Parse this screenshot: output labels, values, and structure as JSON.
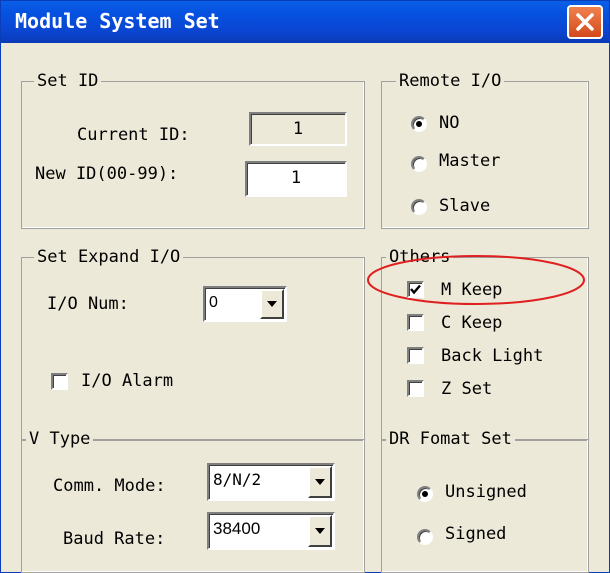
{
  "window": {
    "title": "Module System Set"
  },
  "set_id": {
    "label": "Set ID",
    "current_label": "Current ID:",
    "current_value": "1",
    "new_label": "New ID(00-99):",
    "new_value": "1"
  },
  "remote_io": {
    "label": "Remote I/O",
    "options": [
      "NO",
      "Master",
      "Slave"
    ],
    "selected": "NO"
  },
  "expand_io": {
    "label": "Set Expand I/O",
    "num_label": "I/O Num:",
    "num_value": "0",
    "alarm_label": "I/O Alarm",
    "alarm_checked": false
  },
  "others": {
    "label": "Others",
    "items": [
      {
        "label": "M Keep",
        "checked": true
      },
      {
        "label": "C Keep",
        "checked": false
      },
      {
        "label": "Back Light",
        "checked": false
      },
      {
        "label": "Z Set",
        "checked": false
      }
    ],
    "highlight_color": "#e02020"
  },
  "v_type": {
    "label": "V Type",
    "comm_label": "Comm. Mode:",
    "comm_value": "8/N/2",
    "baud_label": "Baud Rate:",
    "baud_value": "38400"
  },
  "dr_format": {
    "label": "DR Fomat Set",
    "options": [
      "Unsigned",
      "Signed"
    ],
    "selected": "Unsigned"
  }
}
